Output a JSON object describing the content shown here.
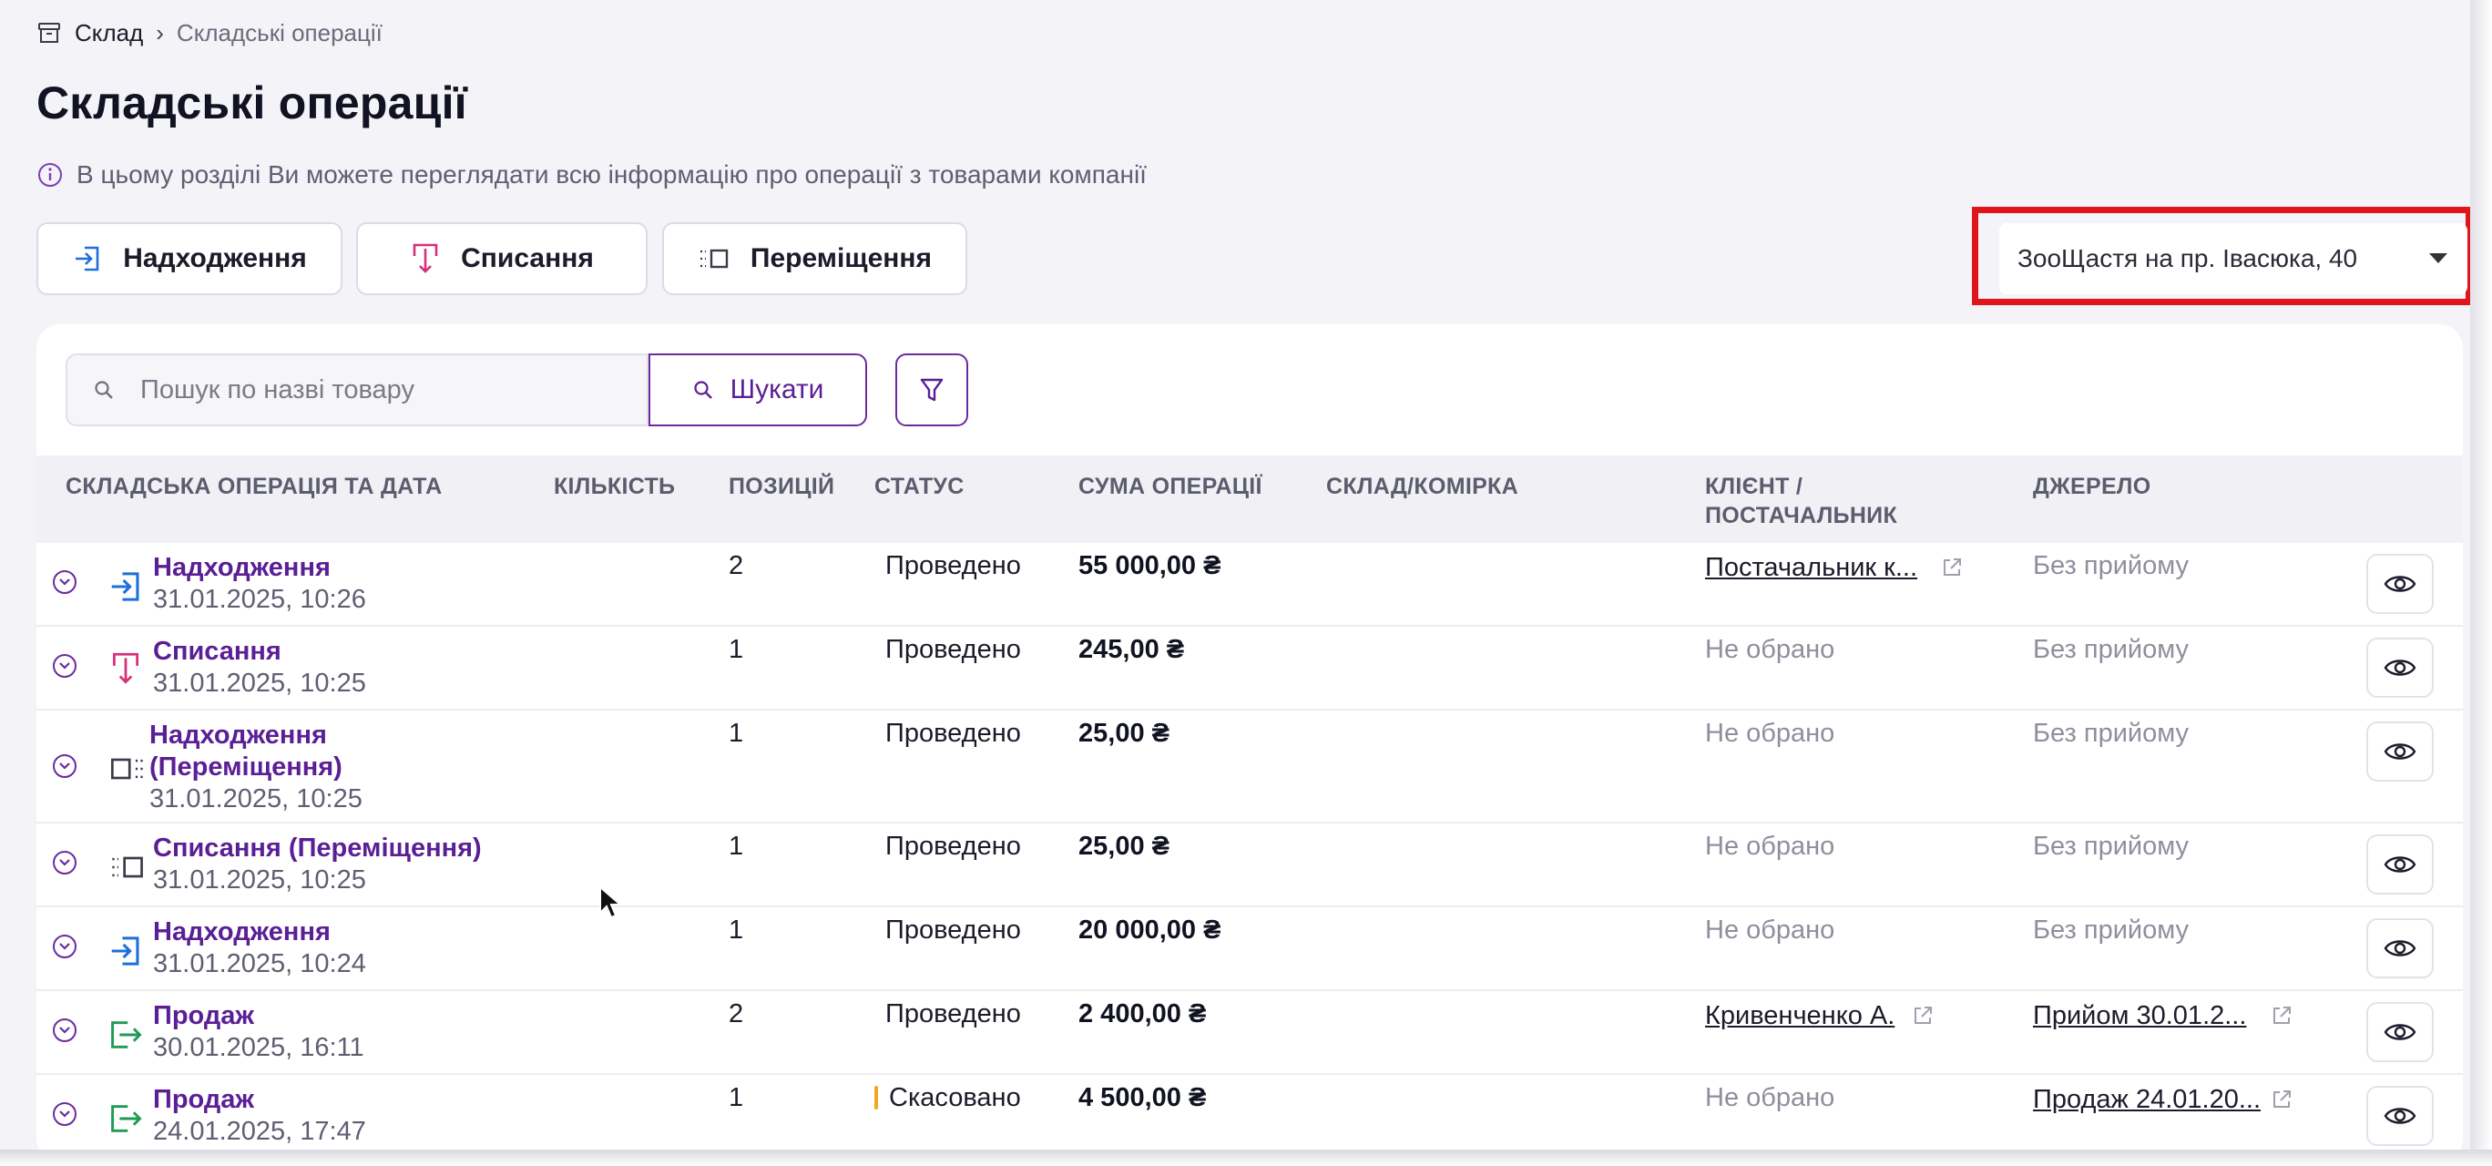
{
  "breadcrumb": {
    "root": "Склад",
    "current": "Складські операції"
  },
  "page": {
    "title": "Складські операції",
    "info": "В цьому розділі Ви можете переглядати всю інформацію про операції з товарами компанії"
  },
  "actions": {
    "income": "Надходження",
    "writeoff": "Списання",
    "move": "Переміщення"
  },
  "warehouse_select": {
    "value": "ЗооЩастя на пр. Івасюка, 40"
  },
  "search": {
    "placeholder": "Пошук по назві товару",
    "value": "",
    "button": "Шукати"
  },
  "table": {
    "columns": {
      "operation": "Складська операція та дата",
      "quantity": "Кількість",
      "positions": "Позицій",
      "status": "Статус",
      "amount": "Сума операції",
      "warehouse": "Склад/Комірка",
      "client_1": "Клієнт /",
      "client_2": "Постачальник",
      "source": "Джерело"
    },
    "rows": [
      {
        "name": "Надходження",
        "date": "31.01.2025, 10:26",
        "positions": "2",
        "status": "Проведено",
        "amount": "55 000,00 ₴",
        "client": "Постачальник к...",
        "source": "Без прийому"
      },
      {
        "name": "Списання",
        "date": "31.01.2025, 10:25",
        "positions": "1",
        "status": "Проведено",
        "amount": "245,00 ₴",
        "client": "Не обрано",
        "source": "Без прийому"
      },
      {
        "name_1": "Надходження",
        "name_2": "(Переміщення)",
        "date": "31.01.2025, 10:25",
        "positions": "1",
        "status": "Проведено",
        "amount": "25,00 ₴",
        "client": "Не обрано",
        "source": "Без прийому"
      },
      {
        "name": "Списання (Переміщення)",
        "date": "31.01.2025, 10:25",
        "positions": "1",
        "status": "Проведено",
        "amount": "25,00 ₴",
        "client": "Не обрано",
        "source": "Без прийому"
      },
      {
        "name": "Надходження",
        "date": "31.01.2025, 10:24",
        "positions": "1",
        "status": "Проведено",
        "amount": "20 000,00 ₴",
        "client": "Не обрано",
        "source": "Без прийому"
      },
      {
        "name": "Продаж",
        "date": "30.01.2025, 16:11",
        "positions": "2",
        "status": "Проведено",
        "amount": "2 400,00 ₴",
        "client": "Кривенченко А.",
        "source": "Прийом 30.01.2..."
      },
      {
        "name": "Продаж",
        "date": "24.01.2025, 17:47",
        "positions": "1",
        "status": "Скасовано",
        "amount": "4 500,00 ₴",
        "client": "Не обрано",
        "source": "Продаж 24.01.20..."
      }
    ]
  },
  "colors": {
    "accent": "#5b1f95",
    "income_icon": "#1e6fd9",
    "writeoff_icon": "#d6307a",
    "sale_icon": "#1f9a55",
    "highlight": "#e0141b",
    "cancel_marker": "#f2a81e"
  },
  "icons": {
    "breadcrumb": "archive-icon",
    "info": "info-icon",
    "income": "income-arrow-icon",
    "writeoff": "writeoff-arrow-icon",
    "move": "move-icon",
    "sale": "sale-exit-icon",
    "expand": "chevron-down-icon",
    "view": "eye-icon",
    "external": "external-link-icon",
    "filter": "filter-icon",
    "search": "search-icon"
  }
}
